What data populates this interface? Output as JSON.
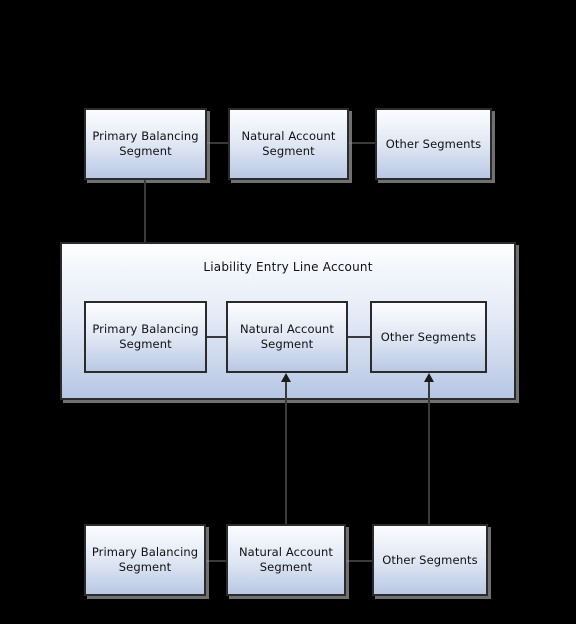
{
  "diagram": {
    "title_group": "Liability Entry Line Account",
    "top_row": [
      {
        "id": "top-primary-balancing-segment",
        "label": "Primary Balancing\nSegment"
      },
      {
        "id": "top-natural-account-segment",
        "label": "Natural Account\nSegment"
      },
      {
        "id": "top-other-segments",
        "label": "Other Segments"
      }
    ],
    "middle_row": [
      {
        "id": "mid-primary-balancing-segment",
        "label": "Primary Balancing\nSegment"
      },
      {
        "id": "mid-natural-account-segment",
        "label": "Natural Account\nSegment"
      },
      {
        "id": "mid-other-segments",
        "label": "Other Segments"
      }
    ],
    "bottom_row": [
      {
        "id": "bottom-primary-balancing-segment",
        "label": "Primary Balancing\nSegment"
      },
      {
        "id": "bottom-natural-account-segment",
        "label": "Natural Account\nSegment"
      },
      {
        "id": "bottom-other-segments",
        "label": "Other Segments"
      }
    ],
    "colors": {
      "background": "#000000",
      "box_border": "#2b2b2b",
      "box_fill_top": "#fdfdff",
      "box_fill_bottom": "#b9c8e4",
      "connector": "#3a3a3a",
      "text": "#111111"
    }
  }
}
